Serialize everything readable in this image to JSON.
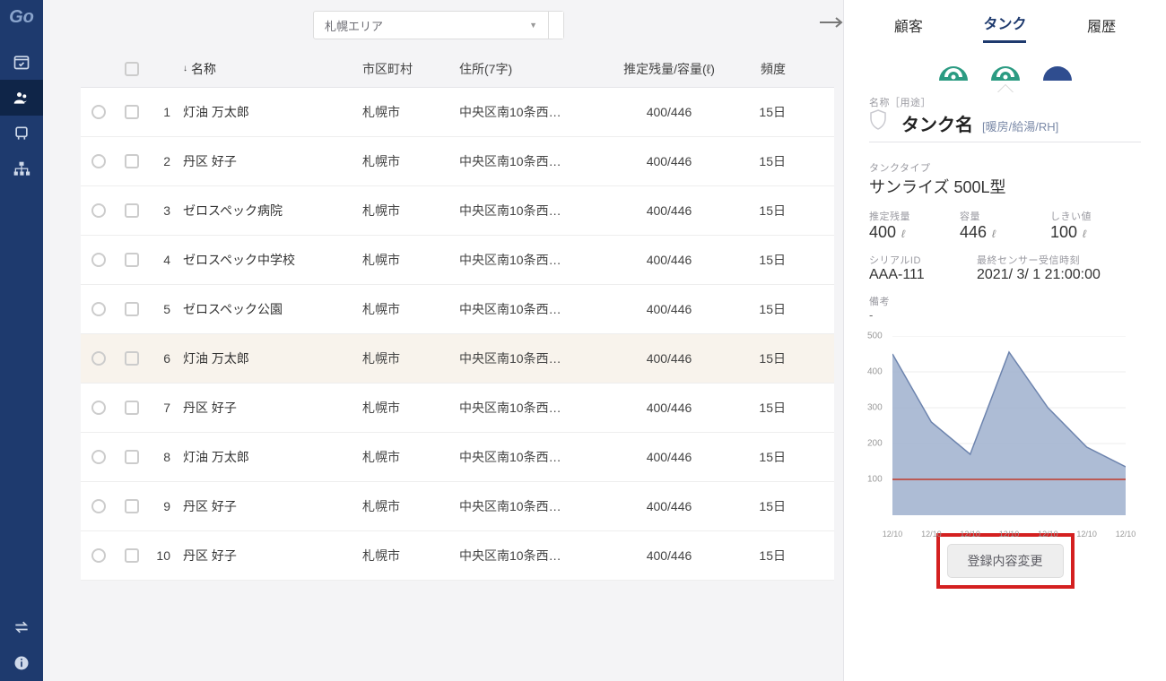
{
  "rail": {
    "logo": "Go"
  },
  "topbar": {
    "area_label": "札幌エリア"
  },
  "table": {
    "headers": {
      "name": "名称",
      "city": "市区町村",
      "addr": "住所(7字)",
      "vol": "推定残量/容量(ℓ)",
      "freq": "頻度"
    },
    "rows": [
      {
        "idx": "1",
        "name": "灯油 万太郎",
        "city": "札幌市",
        "addr": "中央区南10条西…",
        "vol": "400/446",
        "freq": "15日",
        "sel": false
      },
      {
        "idx": "2",
        "name": "丹区 好子",
        "city": "札幌市",
        "addr": "中央区南10条西…",
        "vol": "400/446",
        "freq": "15日",
        "sel": false
      },
      {
        "idx": "3",
        "name": "ゼロスペック病院",
        "city": "札幌市",
        "addr": "中央区南10条西…",
        "vol": "400/446",
        "freq": "15日",
        "sel": false
      },
      {
        "idx": "4",
        "name": "ゼロスペック中学校",
        "city": "札幌市",
        "addr": "中央区南10条西…",
        "vol": "400/446",
        "freq": "15日",
        "sel": false
      },
      {
        "idx": "5",
        "name": "ゼロスペック公園",
        "city": "札幌市",
        "addr": "中央区南10条西…",
        "vol": "400/446",
        "freq": "15日",
        "sel": false
      },
      {
        "idx": "6",
        "name": "灯油 万太郎",
        "city": "札幌市",
        "addr": "中央区南10条西…",
        "vol": "400/446",
        "freq": "15日",
        "sel": true
      },
      {
        "idx": "7",
        "name": "丹区 好子",
        "city": "札幌市",
        "addr": "中央区南10条西…",
        "vol": "400/446",
        "freq": "15日",
        "sel": false
      },
      {
        "idx": "8",
        "name": "灯油 万太郎",
        "city": "札幌市",
        "addr": "中央区南10条西…",
        "vol": "400/446",
        "freq": "15日",
        "sel": false
      },
      {
        "idx": "9",
        "name": "丹区 好子",
        "city": "札幌市",
        "addr": "中央区南10条西…",
        "vol": "400/446",
        "freq": "15日",
        "sel": false
      },
      {
        "idx": "10",
        "name": "丹区 好子",
        "city": "札幌市",
        "addr": "中央区南10条西…",
        "vol": "400/446",
        "freq": "15日",
        "sel": false
      }
    ]
  },
  "panel": {
    "tabs": {
      "customer": "顧客",
      "tank": "タンク",
      "history": "履歴"
    },
    "title_label": "名称［用途］",
    "tank_name": "タンク名",
    "tank_usage": "[暖房/給湯/RH]",
    "type_label": "タンクタイプ",
    "type_value": "サンライズ 500L型",
    "remain_label": "推定残量",
    "remain_value": "400",
    "capacity_label": "容量",
    "capacity_value": "446",
    "threshold_label": "しきい値",
    "threshold_value": "100",
    "unit": "ℓ",
    "serial_label": "シリアルID",
    "serial_value": "AAA-111",
    "lastrx_label": "最終センサー受信時刻",
    "lastrx_value": "2021/ 3/ 1   21:00:00",
    "note_label": "備考",
    "note_value": "-",
    "button": "登録内容変更"
  },
  "chart_data": {
    "type": "area",
    "x": [
      "12/10",
      "12/10",
      "12/10",
      "12/10",
      "12/10",
      "12/10",
      "12/10"
    ],
    "values": [
      450,
      260,
      170,
      455,
      300,
      190,
      135
    ],
    "threshold": 100,
    "ylim": [
      0,
      500
    ],
    "yticks": [
      100,
      200,
      300,
      400,
      500
    ],
    "ylabel": "",
    "xlabel": ""
  }
}
